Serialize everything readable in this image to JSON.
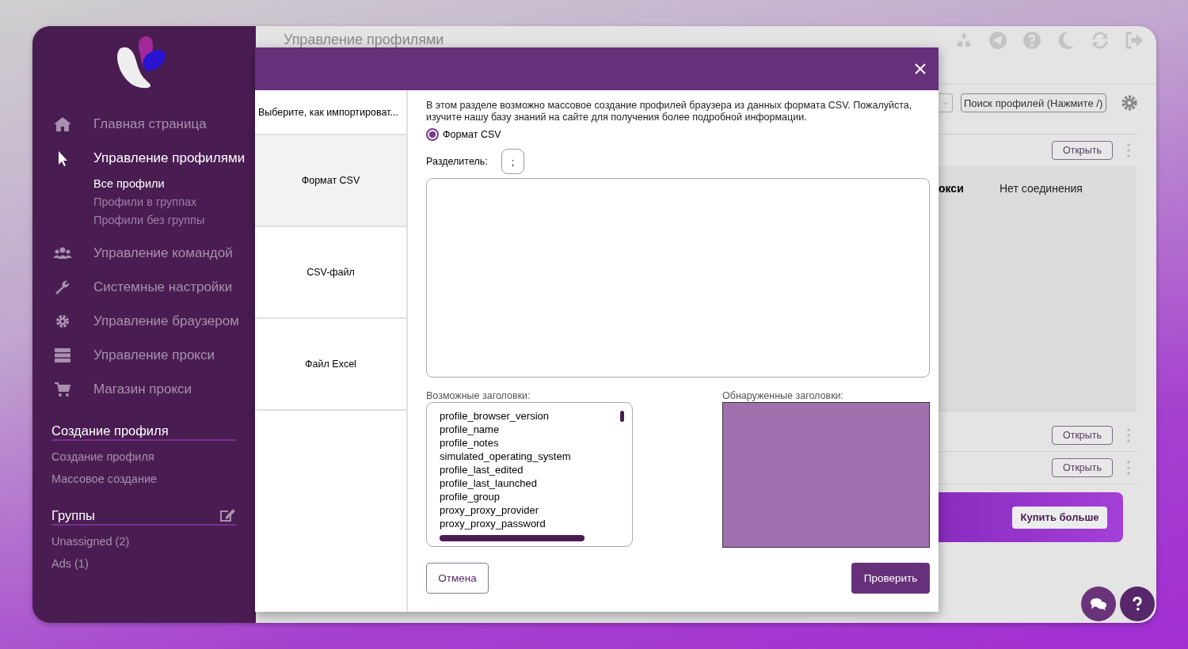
{
  "sidebar": {
    "nav": [
      {
        "label": "Главная страница",
        "kind": "home",
        "selected": false
      },
      {
        "label": "Управление профилями",
        "kind": "cursor",
        "selected": true,
        "children": [
          {
            "label": "Все профили",
            "selected": true
          },
          {
            "label": "Профили в группах",
            "selected": false
          },
          {
            "label": "Профили без группы",
            "selected": false
          }
        ]
      },
      {
        "label": "Управление командой",
        "kind": "users",
        "selected": false
      },
      {
        "label": "Системные настройки",
        "kind": "wrench",
        "selected": false
      },
      {
        "label": "Управление браузером",
        "kind": "gear",
        "selected": false
      },
      {
        "label": "Управление прокси",
        "kind": "server",
        "selected": false
      },
      {
        "label": "Магазин прокси",
        "kind": "cart",
        "selected": false
      }
    ],
    "sections": [
      {
        "title": "Создание профиля",
        "kind": "links",
        "items": [
          "Создание профиля",
          "Массовое создание"
        ]
      },
      {
        "title": "Группы",
        "kind": "groups",
        "items": [
          "Unassigned (2)",
          "Ads (1)"
        ]
      }
    ]
  },
  "page": {
    "title": "Управление профилями",
    "search": {
      "placeholder": "Поиск профилей (Нажмите /)"
    },
    "top_row": {
      "button": "Открыть"
    },
    "details": {
      "label": "окси",
      "value": "Нет соединения"
    },
    "rows": [
      {
        "button": "Открыть"
      },
      {
        "button": "Открыть"
      }
    ],
    "banner": {
      "button": "Купить больше"
    }
  },
  "modal": {
    "tabs_header": "Выберите, как импортироват...",
    "tabs": [
      {
        "label": "Формат CSV",
        "selected": true
      },
      {
        "label": "CSV-файл",
        "selected": false
      },
      {
        "label": "Файл Excel",
        "selected": false
      }
    ],
    "description": "В этом разделе возможно массовое создание профилей браузера из данных формата CSV. Пожалуйста, изучите нашу базу знаний на сайте для получения более подробной информации.",
    "format": {
      "label": "Формат CSV",
      "selected": true
    },
    "separator": {
      "label": "Разделитель:",
      "value": ";"
    },
    "possible_headers": {
      "label": "Возможные заголовки:",
      "items": [
        "profile_browser_version",
        "profile_name",
        "profile_notes",
        "simulated_operating_system",
        "profile_last_edited",
        "profile_last_launched",
        "profile_group",
        "proxy_proxy_provider",
        "proxy_proxy_password"
      ]
    },
    "detected_headers": {
      "label": "Обнаруженные заголовки:"
    },
    "cancel": "Отмена",
    "verify": "Проверить"
  }
}
